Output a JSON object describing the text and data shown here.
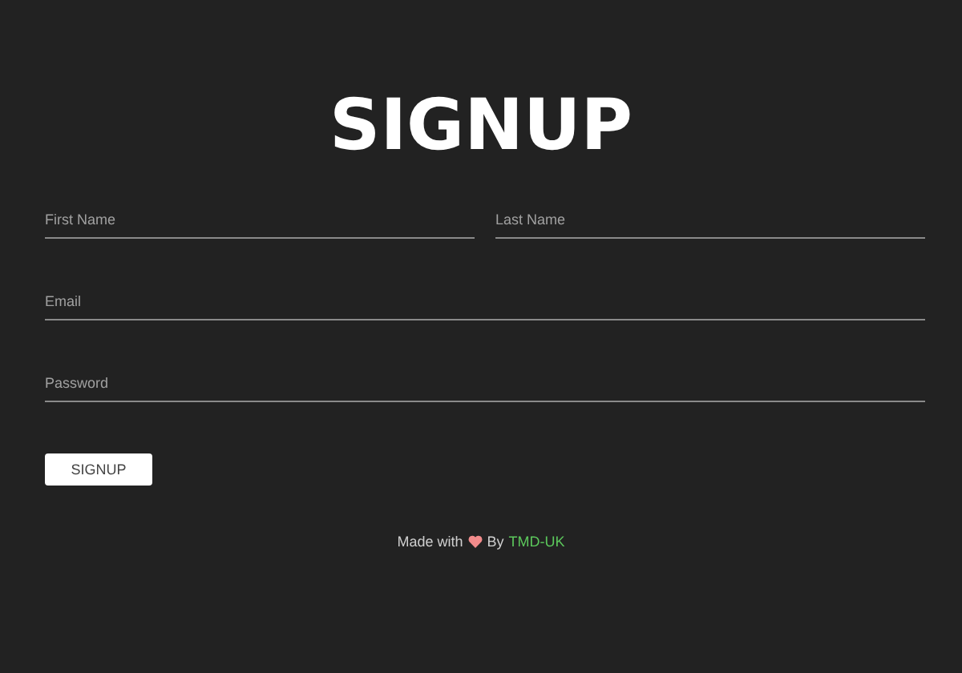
{
  "title": "SIGNUP",
  "fields": [
    {
      "placeholder": "First Name"
    },
    {
      "placeholder": "Last Name"
    },
    {
      "placeholder": "Email"
    },
    {
      "placeholder": "Password"
    }
  ],
  "submit": "SIGNUP",
  "footer": {
    "prefix": "Made with",
    "by": "By",
    "link": "TMD-UK"
  }
}
